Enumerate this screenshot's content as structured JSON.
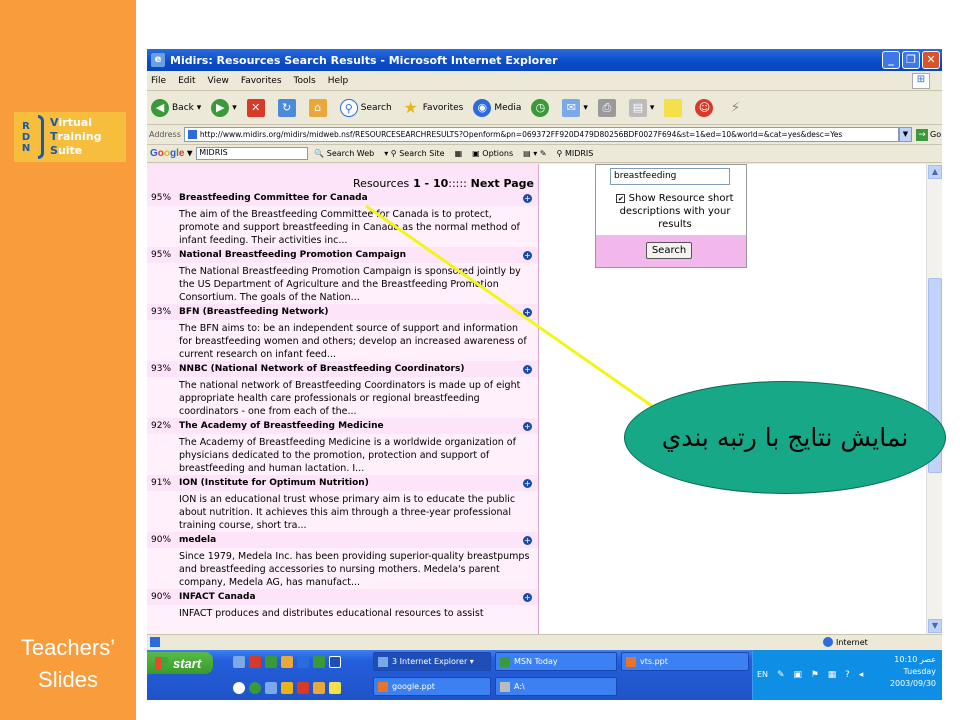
{
  "slide": {
    "logo": {
      "rdn": [
        "R",
        "D",
        "N"
      ],
      "words": [
        {
          "first": "V",
          "rest": "irtual"
        },
        {
          "first": "T",
          "rest": "raining"
        },
        {
          "first": "S",
          "rest": "uite"
        }
      ]
    },
    "footer_line1": "Teachers’",
    "footer_line2": "Slides",
    "callout_text": "نمايش نتايج با رتبه بندي"
  },
  "window": {
    "title": "Midirs: Resources Search Results - Microsoft Internet Explorer",
    "controls": [
      "_",
      "❐",
      "✕"
    ]
  },
  "menu": [
    "File",
    "Edit",
    "View",
    "Favorites",
    "Tools",
    "Help"
  ],
  "toolbar": {
    "back": "Back",
    "search": "Search",
    "favorites": "Favorites",
    "media": "Media"
  },
  "address": {
    "label": "Address",
    "url": "http://www.midirs.org/midirs/midweb.nsf/RESOURCESEARCHRESULTS?Openform&pn=069372FF920D479D80256BDF0027F694&st=1&ed=10&world=&cat=yes&desc=Yes",
    "go": "Go"
  },
  "googlebar": {
    "search_value": "MIDRIS",
    "search_web": "Search Web",
    "search_site": "Search Site",
    "options": "Options",
    "midris": "MIDRIS"
  },
  "results": {
    "header_label": "Resources",
    "header_range": "1 - 10",
    "header_sep": ":::::",
    "next": "Next Page",
    "items": [
      {
        "pct": "95%",
        "title": "Breastfeeding Committee for Canada",
        "desc": "The aim of the Breastfeeding Committee for Canada is to protect, promote and support breastfeeding in Canada as the normal method of infant feeding. Their activities inc..."
      },
      {
        "pct": "95%",
        "title": "National Breastfeeding Promotion Campaign",
        "desc": "The National Breastfeeding Promotion Campaign is sponsored jointly by the US Department of Agriculture and the Breastfeeding Promotion Consortium. The goals of the Nation..."
      },
      {
        "pct": "93%",
        "title": "BFN (Breastfeeding Network)",
        "desc": "The BFN aims to: be an independent source of support and information for breastfeeding women and others; develop an increased awareness of current research on infant feed..."
      },
      {
        "pct": "93%",
        "title": "NNBC (National Network of Breastfeeding Coordinators)",
        "desc": "The national network of Breastfeeding Coordinators is made up of eight appropriate health care professionals or regional breastfeeding coordinators - one from each of the..."
      },
      {
        "pct": "92%",
        "title": "The Academy of Breastfeeding Medicine",
        "desc": "The Academy of Breastfeeding Medicine is a worldwide organization of physicians dedicated to the promotion, protection and support of breastfeeding and human lactation. I..."
      },
      {
        "pct": "91%",
        "title": "ION (Institute for Optimum Nutrition)",
        "desc": "ION is an educational trust whose primary aim is to educate the public about nutrition. It achieves this aim through a three-year professional training course, short tra..."
      },
      {
        "pct": "90%",
        "title": "medela",
        "desc": "Since 1979, Medela Inc. has been providing superior-quality breastpumps and breastfeeding accessories to nursing mothers. Medela's parent company, Medela AG, has manufact..."
      },
      {
        "pct": "90%",
        "title": "INFACT Canada",
        "desc": "INFACT produces and distributes educational resources to assist"
      }
    ]
  },
  "search_panel": {
    "value": "breastfeeding",
    "show_desc": "Show Resource short descriptions with your results",
    "button": "Search"
  },
  "status": {
    "zone": "Internet"
  },
  "taskbar": {
    "start": "start",
    "tasks": [
      "3 Internet Explorer",
      "MSN Today",
      "vts.ppt",
      "google.ppt",
      "A:\\"
    ],
    "lang": "EN",
    "clock_time": "10:10 عصر",
    "clock_day": "Tuesday",
    "clock_date": "2003/09/30"
  }
}
